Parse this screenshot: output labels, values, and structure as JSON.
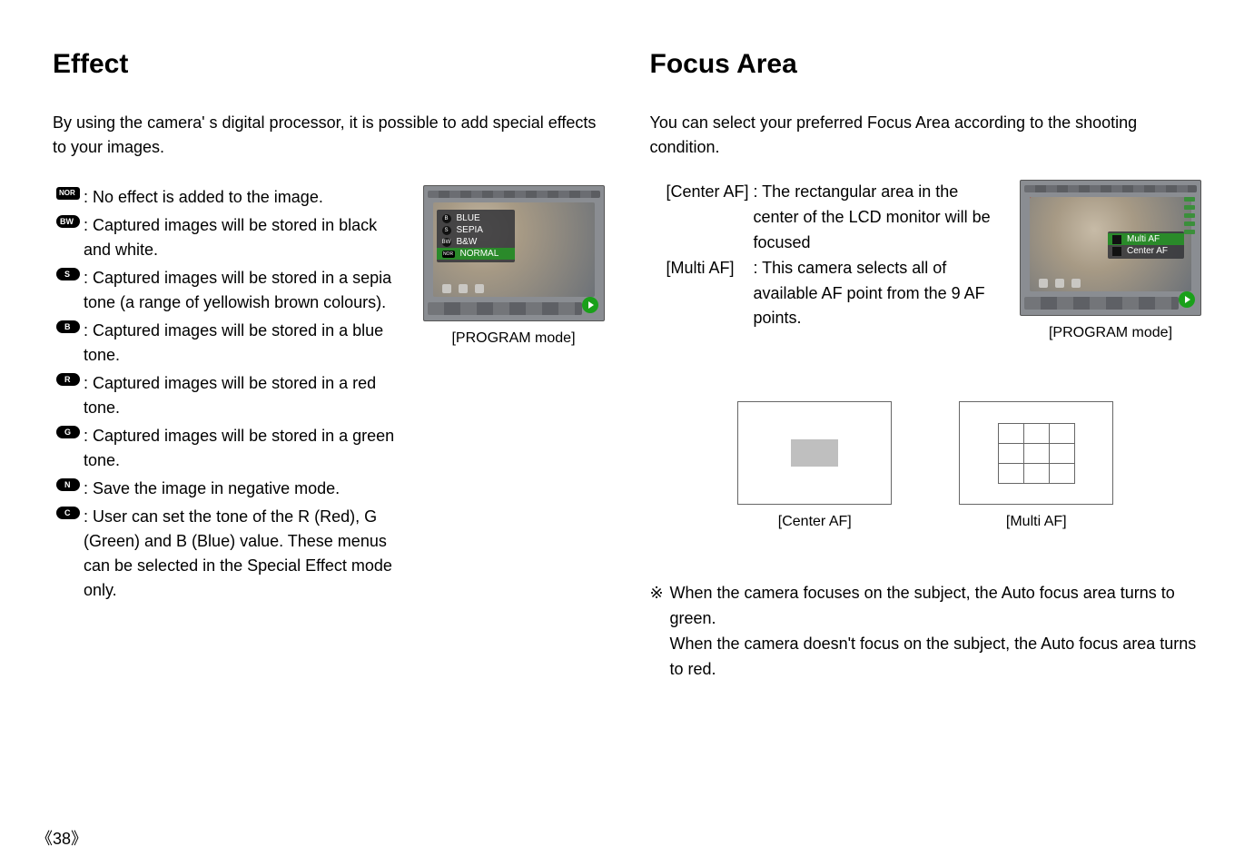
{
  "left": {
    "heading": "Effect",
    "intro": "By using the camera' s digital processor, it is possible to add special effects to your images.",
    "items": [
      {
        "iconType": "nor",
        "iconLabel": "NOR",
        "text": ": No effect is added to the image."
      },
      {
        "iconType": "pill",
        "iconLabel": "BW",
        "text": ": Captured images will be stored in black and white."
      },
      {
        "iconType": "pill",
        "iconLabel": "S",
        "text": ": Captured images will be stored in a sepia tone (a range of yellowish brown colours)."
      },
      {
        "iconType": "pill",
        "iconLabel": "B",
        "text": ": Captured images will be stored in a blue tone."
      },
      {
        "iconType": "pill",
        "iconLabel": "R",
        "text": ": Captured images will be stored in a red tone."
      },
      {
        "iconType": "pill",
        "iconLabel": "G",
        "text": ": Captured images will be stored in a green tone."
      },
      {
        "iconType": "pill",
        "iconLabel": "N",
        "text": ": Save the image in negative mode."
      },
      {
        "iconType": "pill",
        "iconLabel": "C",
        "text": ": User can set the tone of the R (Red), G (Green) and B (Blue) value. These menus can be selected in the Special Effect mode only."
      }
    ],
    "menu": {
      "blue": "BLUE",
      "sepia": "SEPIA",
      "bw": "B&W",
      "normal": "NORMAL"
    },
    "shotCaption": "[PROGRAM mode]"
  },
  "right": {
    "heading": "Focus Area",
    "intro": "You can select your preferred Focus Area according to the shooting condition.",
    "defs": [
      {
        "term": "[Center AF]",
        "val": ": The rectangular area in the center of the LCD monitor will be focused"
      },
      {
        "term": "[Multi AF]",
        "val": ": This camera selects all of available AF point from the 9 AF points."
      }
    ],
    "menu": {
      "multi": "Multi AF",
      "center": "Center AF"
    },
    "shotCaption": "[PROGRAM mode]",
    "centerLabel": "[Center AF]",
    "multiLabel": "[Multi AF]",
    "noteSym": "※",
    "note1": "When the camera focuses on the subject, the Auto focus area turns to green.",
    "note2": "When the camera doesn't focus on the subject, the Auto focus area turns to red."
  },
  "pageNumber": "38"
}
